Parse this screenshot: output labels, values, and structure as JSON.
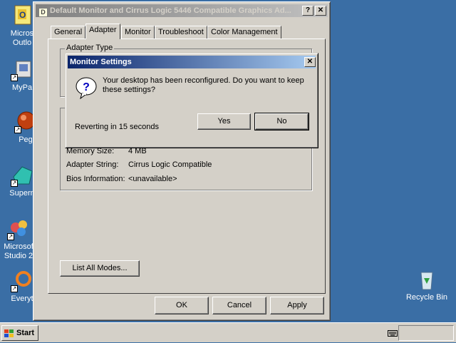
{
  "desktop": {
    "icons": [
      {
        "label": "Micros\nOutlo",
        "icon": "outlook-icon"
      },
      {
        "label": "MyPa",
        "icon": "my-documents-icon"
      },
      {
        "label": "Peg",
        "icon": "pegasus-icon"
      },
      {
        "label": "Supern",
        "icon": "supernova-icon"
      },
      {
        "label": "Microsof\nStudio 2",
        "icon": "visual-studio-icon"
      },
      {
        "label": "Everyt",
        "icon": "everything-icon"
      }
    ],
    "recycle_bin": {
      "label": "Recycle Bin",
      "icon": "recycle-bin-icon"
    }
  },
  "properties_window": {
    "title_icon_letter": "D",
    "title": "Default Monitor and Cirrus Logic 5446 Compatible Graphics Ad...",
    "help_button": "?",
    "close_button": "✕",
    "tabs": [
      "General",
      "Adapter",
      "Monitor",
      "Troubleshoot",
      "Color Management"
    ],
    "active_tab": "Adapter",
    "adapter_type_label": "Adapter Type",
    "info_rows": [
      {
        "label": "Memory Size:",
        "value": "4 MB"
      },
      {
        "label": "Adapter String:",
        "value": "Cirrus Logic Compatible"
      },
      {
        "label": "Bios Information:",
        "value": "<unavailable>"
      }
    ],
    "list_all_modes_button": "List All Modes...",
    "ok_button": "OK",
    "cancel_button": "Cancel",
    "apply_button": "Apply"
  },
  "monitor_dialog": {
    "title": "Monitor Settings",
    "close_button": "✕",
    "message": "Your desktop has been reconfigured.  Do you want to keep these settings?",
    "countdown": "Reverting in 15 seconds",
    "yes_button": "Yes",
    "no_button": "No"
  },
  "taskbar": {
    "start_label": "Start"
  }
}
